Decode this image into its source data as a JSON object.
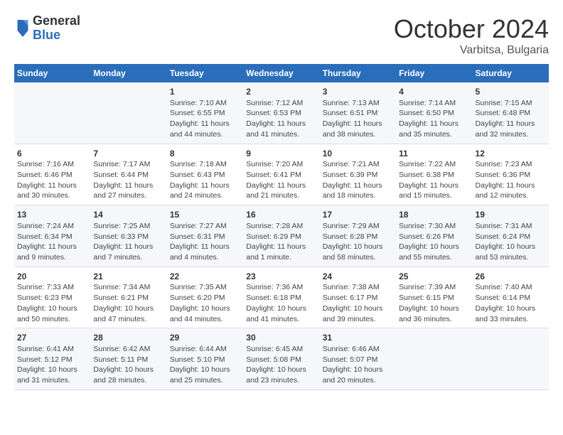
{
  "header": {
    "logo_general": "General",
    "logo_blue": "Blue",
    "month": "October 2024",
    "location": "Varbitsa, Bulgaria"
  },
  "columns": [
    "Sunday",
    "Monday",
    "Tuesday",
    "Wednesday",
    "Thursday",
    "Friday",
    "Saturday"
  ],
  "weeks": [
    [
      {
        "day": "",
        "info": ""
      },
      {
        "day": "",
        "info": ""
      },
      {
        "day": "1",
        "info": "Sunrise: 7:10 AM\nSunset: 6:55 PM\nDaylight: 11 hours and 44 minutes."
      },
      {
        "day": "2",
        "info": "Sunrise: 7:12 AM\nSunset: 6:53 PM\nDaylight: 11 hours and 41 minutes."
      },
      {
        "day": "3",
        "info": "Sunrise: 7:13 AM\nSunset: 6:51 PM\nDaylight: 11 hours and 38 minutes."
      },
      {
        "day": "4",
        "info": "Sunrise: 7:14 AM\nSunset: 6:50 PM\nDaylight: 11 hours and 35 minutes."
      },
      {
        "day": "5",
        "info": "Sunrise: 7:15 AM\nSunset: 6:48 PM\nDaylight: 11 hours and 32 minutes."
      }
    ],
    [
      {
        "day": "6",
        "info": "Sunrise: 7:16 AM\nSunset: 6:46 PM\nDaylight: 11 hours and 30 minutes."
      },
      {
        "day": "7",
        "info": "Sunrise: 7:17 AM\nSunset: 6:44 PM\nDaylight: 11 hours and 27 minutes."
      },
      {
        "day": "8",
        "info": "Sunrise: 7:18 AM\nSunset: 6:43 PM\nDaylight: 11 hours and 24 minutes."
      },
      {
        "day": "9",
        "info": "Sunrise: 7:20 AM\nSunset: 6:41 PM\nDaylight: 11 hours and 21 minutes."
      },
      {
        "day": "10",
        "info": "Sunrise: 7:21 AM\nSunset: 6:39 PM\nDaylight: 11 hours and 18 minutes."
      },
      {
        "day": "11",
        "info": "Sunrise: 7:22 AM\nSunset: 6:38 PM\nDaylight: 11 hours and 15 minutes."
      },
      {
        "day": "12",
        "info": "Sunrise: 7:23 AM\nSunset: 6:36 PM\nDaylight: 11 hours and 12 minutes."
      }
    ],
    [
      {
        "day": "13",
        "info": "Sunrise: 7:24 AM\nSunset: 6:34 PM\nDaylight: 11 hours and 9 minutes."
      },
      {
        "day": "14",
        "info": "Sunrise: 7:25 AM\nSunset: 6:33 PM\nDaylight: 11 hours and 7 minutes."
      },
      {
        "day": "15",
        "info": "Sunrise: 7:27 AM\nSunset: 6:31 PM\nDaylight: 11 hours and 4 minutes."
      },
      {
        "day": "16",
        "info": "Sunrise: 7:28 AM\nSunset: 6:29 PM\nDaylight: 11 hours and 1 minute."
      },
      {
        "day": "17",
        "info": "Sunrise: 7:29 AM\nSunset: 6:28 PM\nDaylight: 10 hours and 58 minutes."
      },
      {
        "day": "18",
        "info": "Sunrise: 7:30 AM\nSunset: 6:26 PM\nDaylight: 10 hours and 55 minutes."
      },
      {
        "day": "19",
        "info": "Sunrise: 7:31 AM\nSunset: 6:24 PM\nDaylight: 10 hours and 53 minutes."
      }
    ],
    [
      {
        "day": "20",
        "info": "Sunrise: 7:33 AM\nSunset: 6:23 PM\nDaylight: 10 hours and 50 minutes."
      },
      {
        "day": "21",
        "info": "Sunrise: 7:34 AM\nSunset: 6:21 PM\nDaylight: 10 hours and 47 minutes."
      },
      {
        "day": "22",
        "info": "Sunrise: 7:35 AM\nSunset: 6:20 PM\nDaylight: 10 hours and 44 minutes."
      },
      {
        "day": "23",
        "info": "Sunrise: 7:36 AM\nSunset: 6:18 PM\nDaylight: 10 hours and 41 minutes."
      },
      {
        "day": "24",
        "info": "Sunrise: 7:38 AM\nSunset: 6:17 PM\nDaylight: 10 hours and 39 minutes."
      },
      {
        "day": "25",
        "info": "Sunrise: 7:39 AM\nSunset: 6:15 PM\nDaylight: 10 hours and 36 minutes."
      },
      {
        "day": "26",
        "info": "Sunrise: 7:40 AM\nSunset: 6:14 PM\nDaylight: 10 hours and 33 minutes."
      }
    ],
    [
      {
        "day": "27",
        "info": "Sunrise: 6:41 AM\nSunset: 5:12 PM\nDaylight: 10 hours and 31 minutes."
      },
      {
        "day": "28",
        "info": "Sunrise: 6:42 AM\nSunset: 5:11 PM\nDaylight: 10 hours and 28 minutes."
      },
      {
        "day": "29",
        "info": "Sunrise: 6:44 AM\nSunset: 5:10 PM\nDaylight: 10 hours and 25 minutes."
      },
      {
        "day": "30",
        "info": "Sunrise: 6:45 AM\nSunset: 5:08 PM\nDaylight: 10 hours and 23 minutes."
      },
      {
        "day": "31",
        "info": "Sunrise: 6:46 AM\nSunset: 5:07 PM\nDaylight: 10 hours and 20 minutes."
      },
      {
        "day": "",
        "info": ""
      },
      {
        "day": "",
        "info": ""
      }
    ]
  ]
}
